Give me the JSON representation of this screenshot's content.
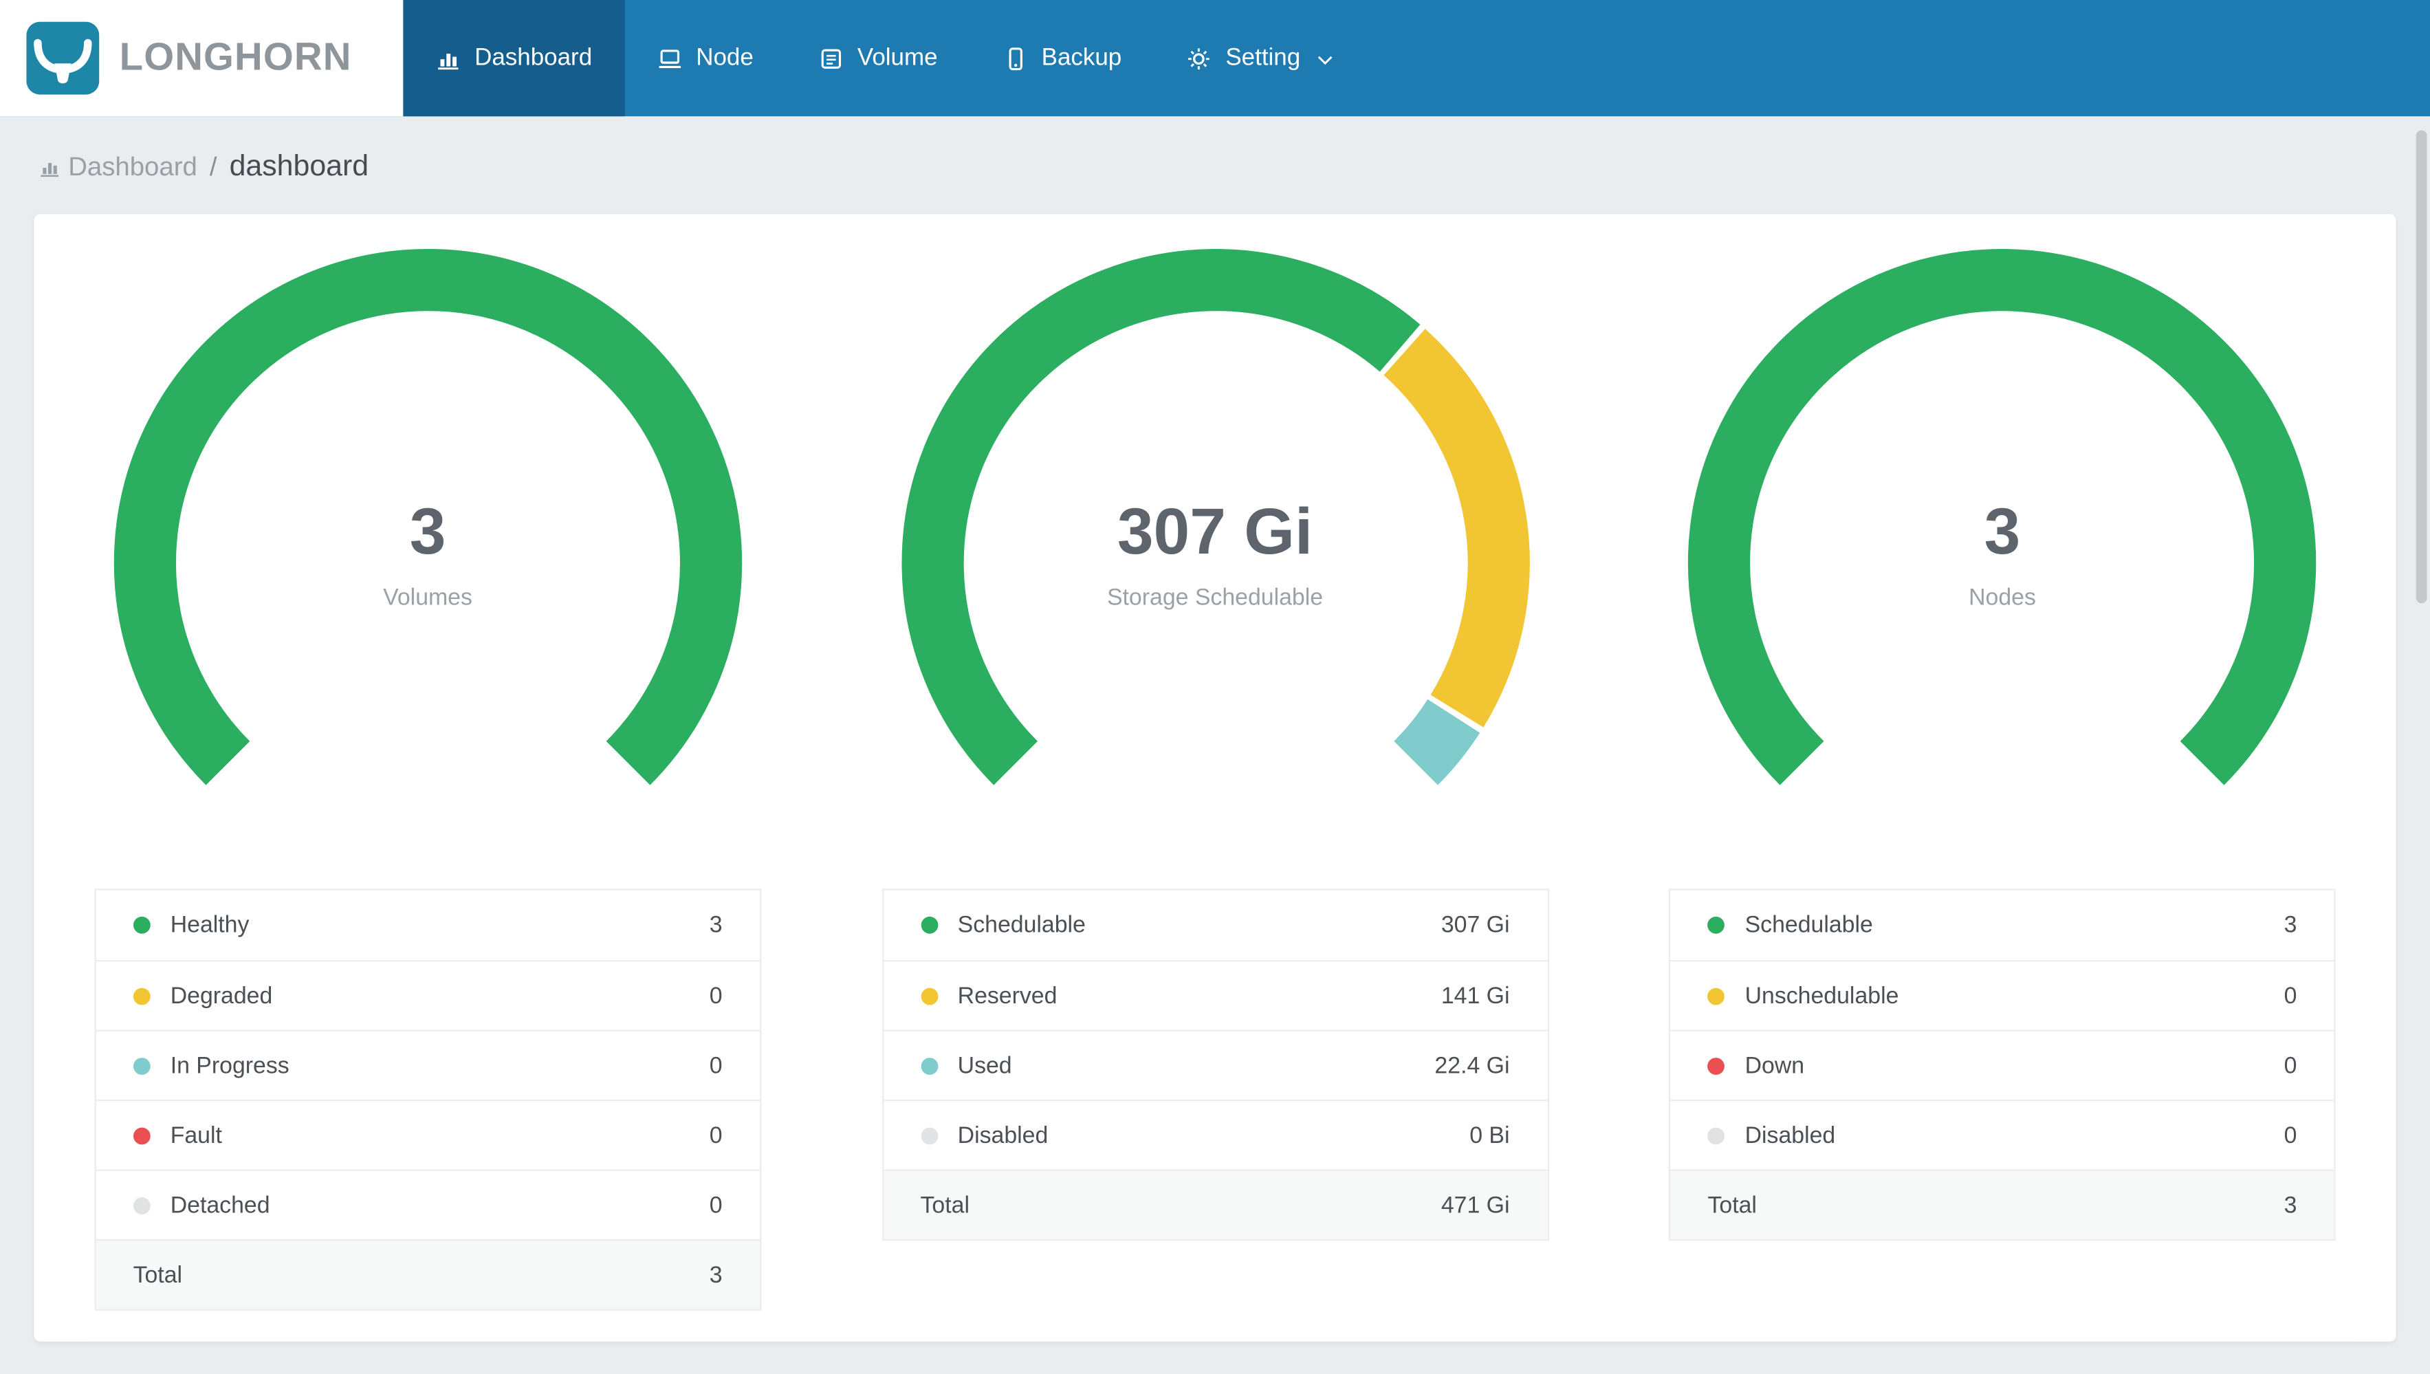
{
  "brand": {
    "name": "LONGHORN",
    "logo": "bull-icon"
  },
  "nav": {
    "items": [
      {
        "id": "dashboard",
        "label": "Dashboard",
        "icon": "bar-chart-icon",
        "active": true,
        "has_dropdown": false
      },
      {
        "id": "node",
        "label": "Node",
        "icon": "laptop-icon",
        "active": false,
        "has_dropdown": false
      },
      {
        "id": "volume",
        "label": "Volume",
        "icon": "disk-icon",
        "active": false,
        "has_dropdown": false
      },
      {
        "id": "backup",
        "label": "Backup",
        "icon": "mobile-icon",
        "active": false,
        "has_dropdown": false
      },
      {
        "id": "setting",
        "label": "Setting",
        "icon": "gear-icon",
        "active": false,
        "has_dropdown": true
      }
    ]
  },
  "breadcrumb": {
    "icon": "bar-chart-icon",
    "section": "Dashboard",
    "separator": "/",
    "current": "dashboard"
  },
  "colors": {
    "page_bg": "#eaedf0",
    "nav_bg": "#1d7bb1",
    "nav_active_bg": "#145d8d",
    "logo_bg": "#1e86a6",
    "green": "#2bae5f",
    "yellow": "#f2c532",
    "teal": "#80cccd",
    "red": "#ea5051",
    "gray": "#e1e2e3"
  },
  "chart_data": [
    {
      "type": "donut-gauge",
      "name": "volumes",
      "title": "Volumes",
      "center_value": "3",
      "center_label": "Volumes",
      "start_angle": 135,
      "sweep": 270,
      "segments": [
        {
          "label": "Healthy",
          "value": 3,
          "display": "3",
          "color_key": "green"
        },
        {
          "label": "Degraded",
          "value": 0,
          "display": "0",
          "color_key": "yellow"
        },
        {
          "label": "In Progress",
          "value": 0,
          "display": "0",
          "color_key": "teal"
        },
        {
          "label": "Fault",
          "value": 0,
          "display": "0",
          "color_key": "red"
        },
        {
          "label": "Detached",
          "value": 0,
          "display": "0",
          "color_key": "gray"
        }
      ],
      "total": {
        "label": "Total",
        "display": "3"
      }
    },
    {
      "type": "donut-gauge",
      "name": "storage",
      "title": "Storage Schedulable",
      "center_value": "307 Gi",
      "center_label": "Storage Schedulable",
      "start_angle": 135,
      "sweep": 270,
      "segments": [
        {
          "label": "Schedulable",
          "value": 307,
          "display": "307 Gi",
          "color_key": "green"
        },
        {
          "label": "Reserved",
          "value": 141,
          "display": "141 Gi",
          "color_key": "yellow"
        },
        {
          "label": "Used",
          "value": 22.4,
          "display": "22.4 Gi",
          "color_key": "teal"
        },
        {
          "label": "Disabled",
          "value": 0,
          "display": "0 Bi",
          "color_key": "gray"
        }
      ],
      "total": {
        "label": "Total",
        "display": "471 Gi"
      }
    },
    {
      "type": "donut-gauge",
      "name": "nodes",
      "title": "Nodes",
      "center_value": "3",
      "center_label": "Nodes",
      "start_angle": 135,
      "sweep": 270,
      "segments": [
        {
          "label": "Schedulable",
          "value": 3,
          "display": "3",
          "color_key": "green"
        },
        {
          "label": "Unschedulable",
          "value": 0,
          "display": "0",
          "color_key": "yellow"
        },
        {
          "label": "Down",
          "value": 0,
          "display": "0",
          "color_key": "red"
        },
        {
          "label": "Disabled",
          "value": 0,
          "display": "0",
          "color_key": "gray"
        }
      ],
      "total": {
        "label": "Total",
        "display": "3"
      }
    }
  ]
}
